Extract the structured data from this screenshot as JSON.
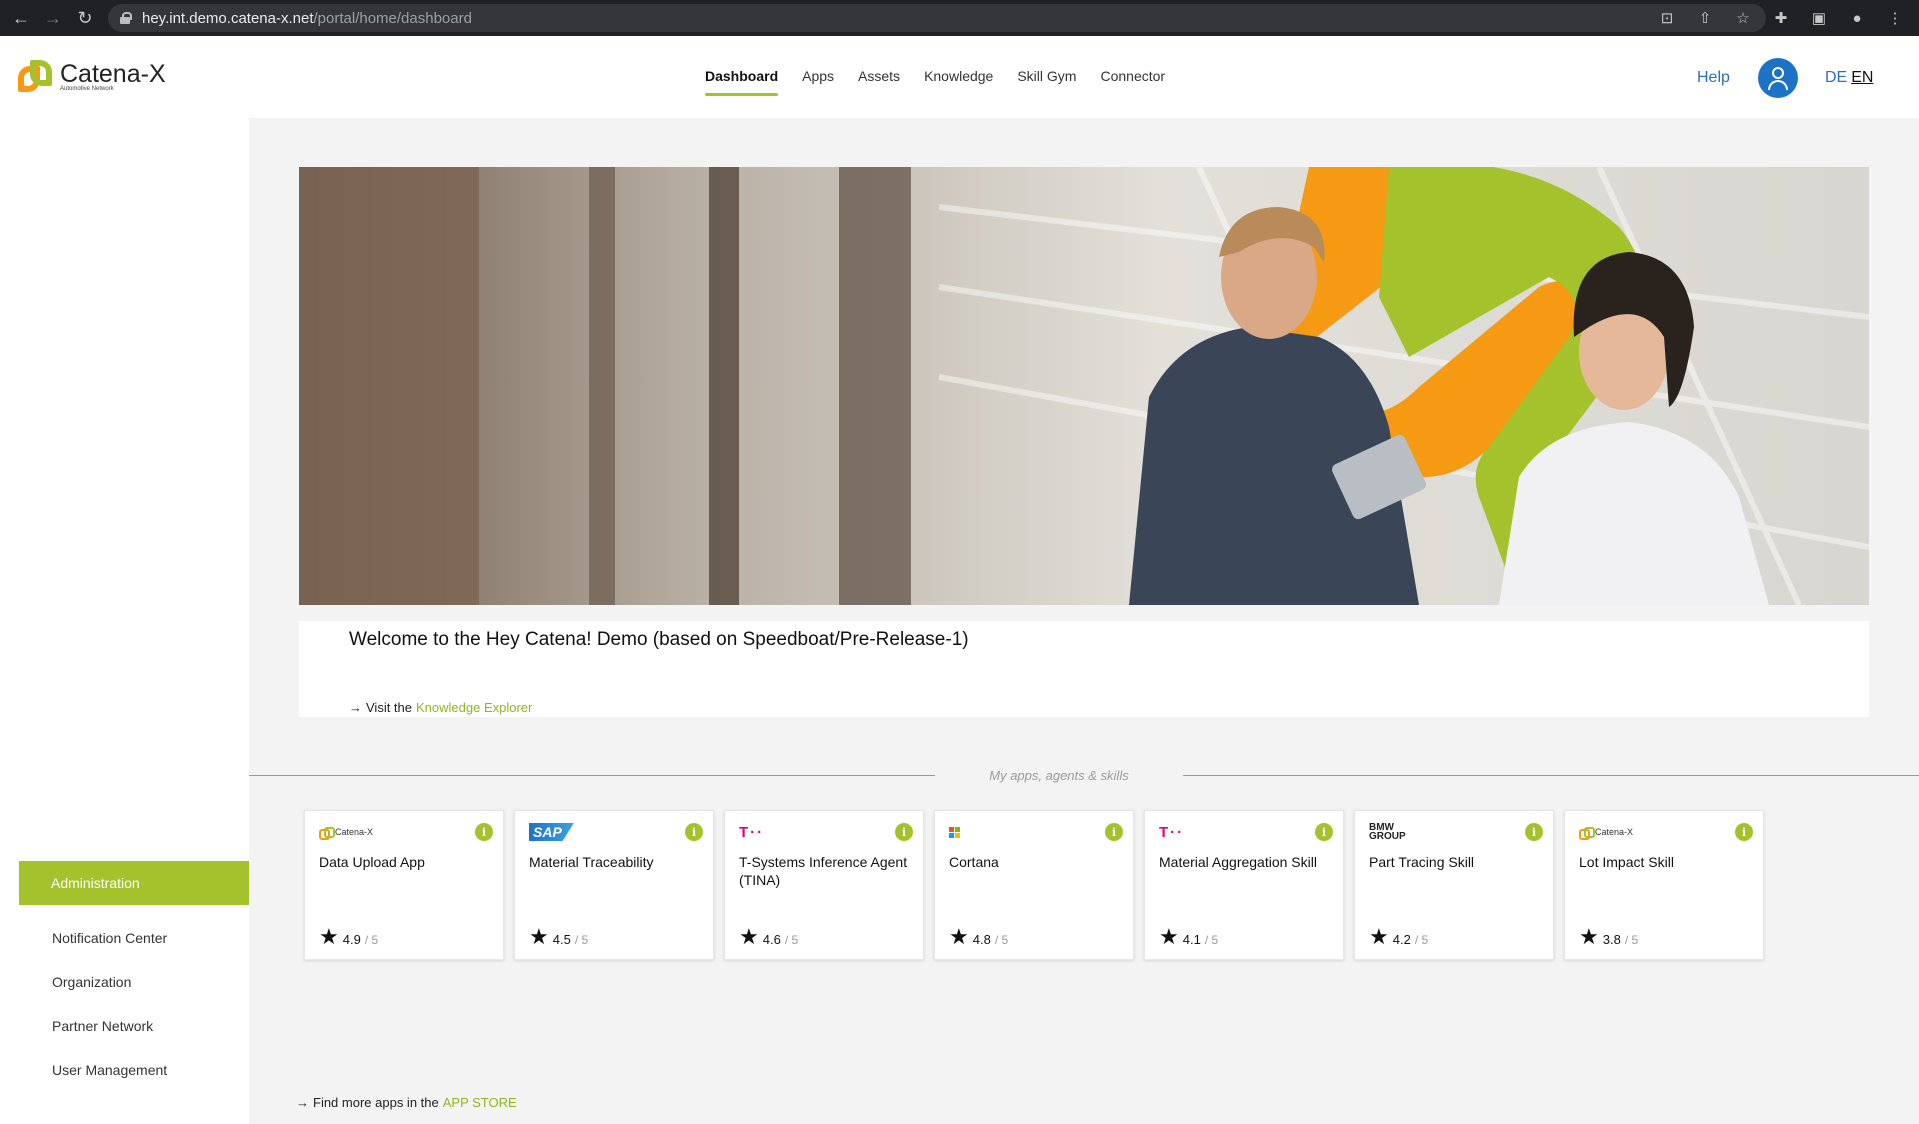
{
  "browser": {
    "url_host": "hey.int.demo.catena-x.net",
    "url_path": "/portal/home/dashboard"
  },
  "header": {
    "logo_title": "Catena-X",
    "logo_subtitle": "Automotive Network",
    "nav": [
      {
        "label": "Dashboard",
        "active": true
      },
      {
        "label": "Apps"
      },
      {
        "label": "Assets"
      },
      {
        "label": "Knowledge"
      },
      {
        "label": "Skill Gym"
      },
      {
        "label": "Connector"
      }
    ],
    "help": "Help",
    "lang_de": "DE",
    "lang_en": "EN"
  },
  "sidebar": {
    "active_item": "Administration",
    "items": [
      "Notification Center",
      "Organization",
      "Partner Network",
      "User Management"
    ]
  },
  "main": {
    "welcome_title": "Welcome to the Hey Catena! Demo (based on Speedboat/Pre-Release-1)",
    "visit_prefix": "Visit the",
    "visit_link": "Knowledge Explorer",
    "section_label": "My apps, agents & skills",
    "cards": [
      {
        "brand": "Catena-X",
        "name": "Data Upload App",
        "rating": "4.9",
        "max": "/ 5"
      },
      {
        "brand": "SAP",
        "name": "Material Traceability",
        "rating": "4.5",
        "max": "/ 5"
      },
      {
        "brand": "T··",
        "name": "T-Systems Inference Agent (TINA)",
        "rating": "4.6",
        "max": "/ 5"
      },
      {
        "brand": "Microsoft",
        "name": "Cortana",
        "rating": "4.8",
        "max": "/ 5"
      },
      {
        "brand": "T··",
        "name": "Material Aggregation Skill",
        "rating": "4.1",
        "max": "/ 5"
      },
      {
        "brand": "BMW GROUP",
        "name": "Part Tracing Skill",
        "rating": "4.2",
        "max": "/ 5"
      },
      {
        "brand": "Catena-X",
        "name": "Lot Impact Skill",
        "rating": "3.8",
        "max": "/ 5"
      }
    ],
    "find_more_prefix": "Find more apps in the",
    "find_more_link": "APP STORE"
  },
  "colors": {
    "accent_green": "#a4c22b",
    "accent_orange": "#f59a12",
    "link_blue": "#2d6fc1",
    "telekom_magenta": "#e20074"
  }
}
